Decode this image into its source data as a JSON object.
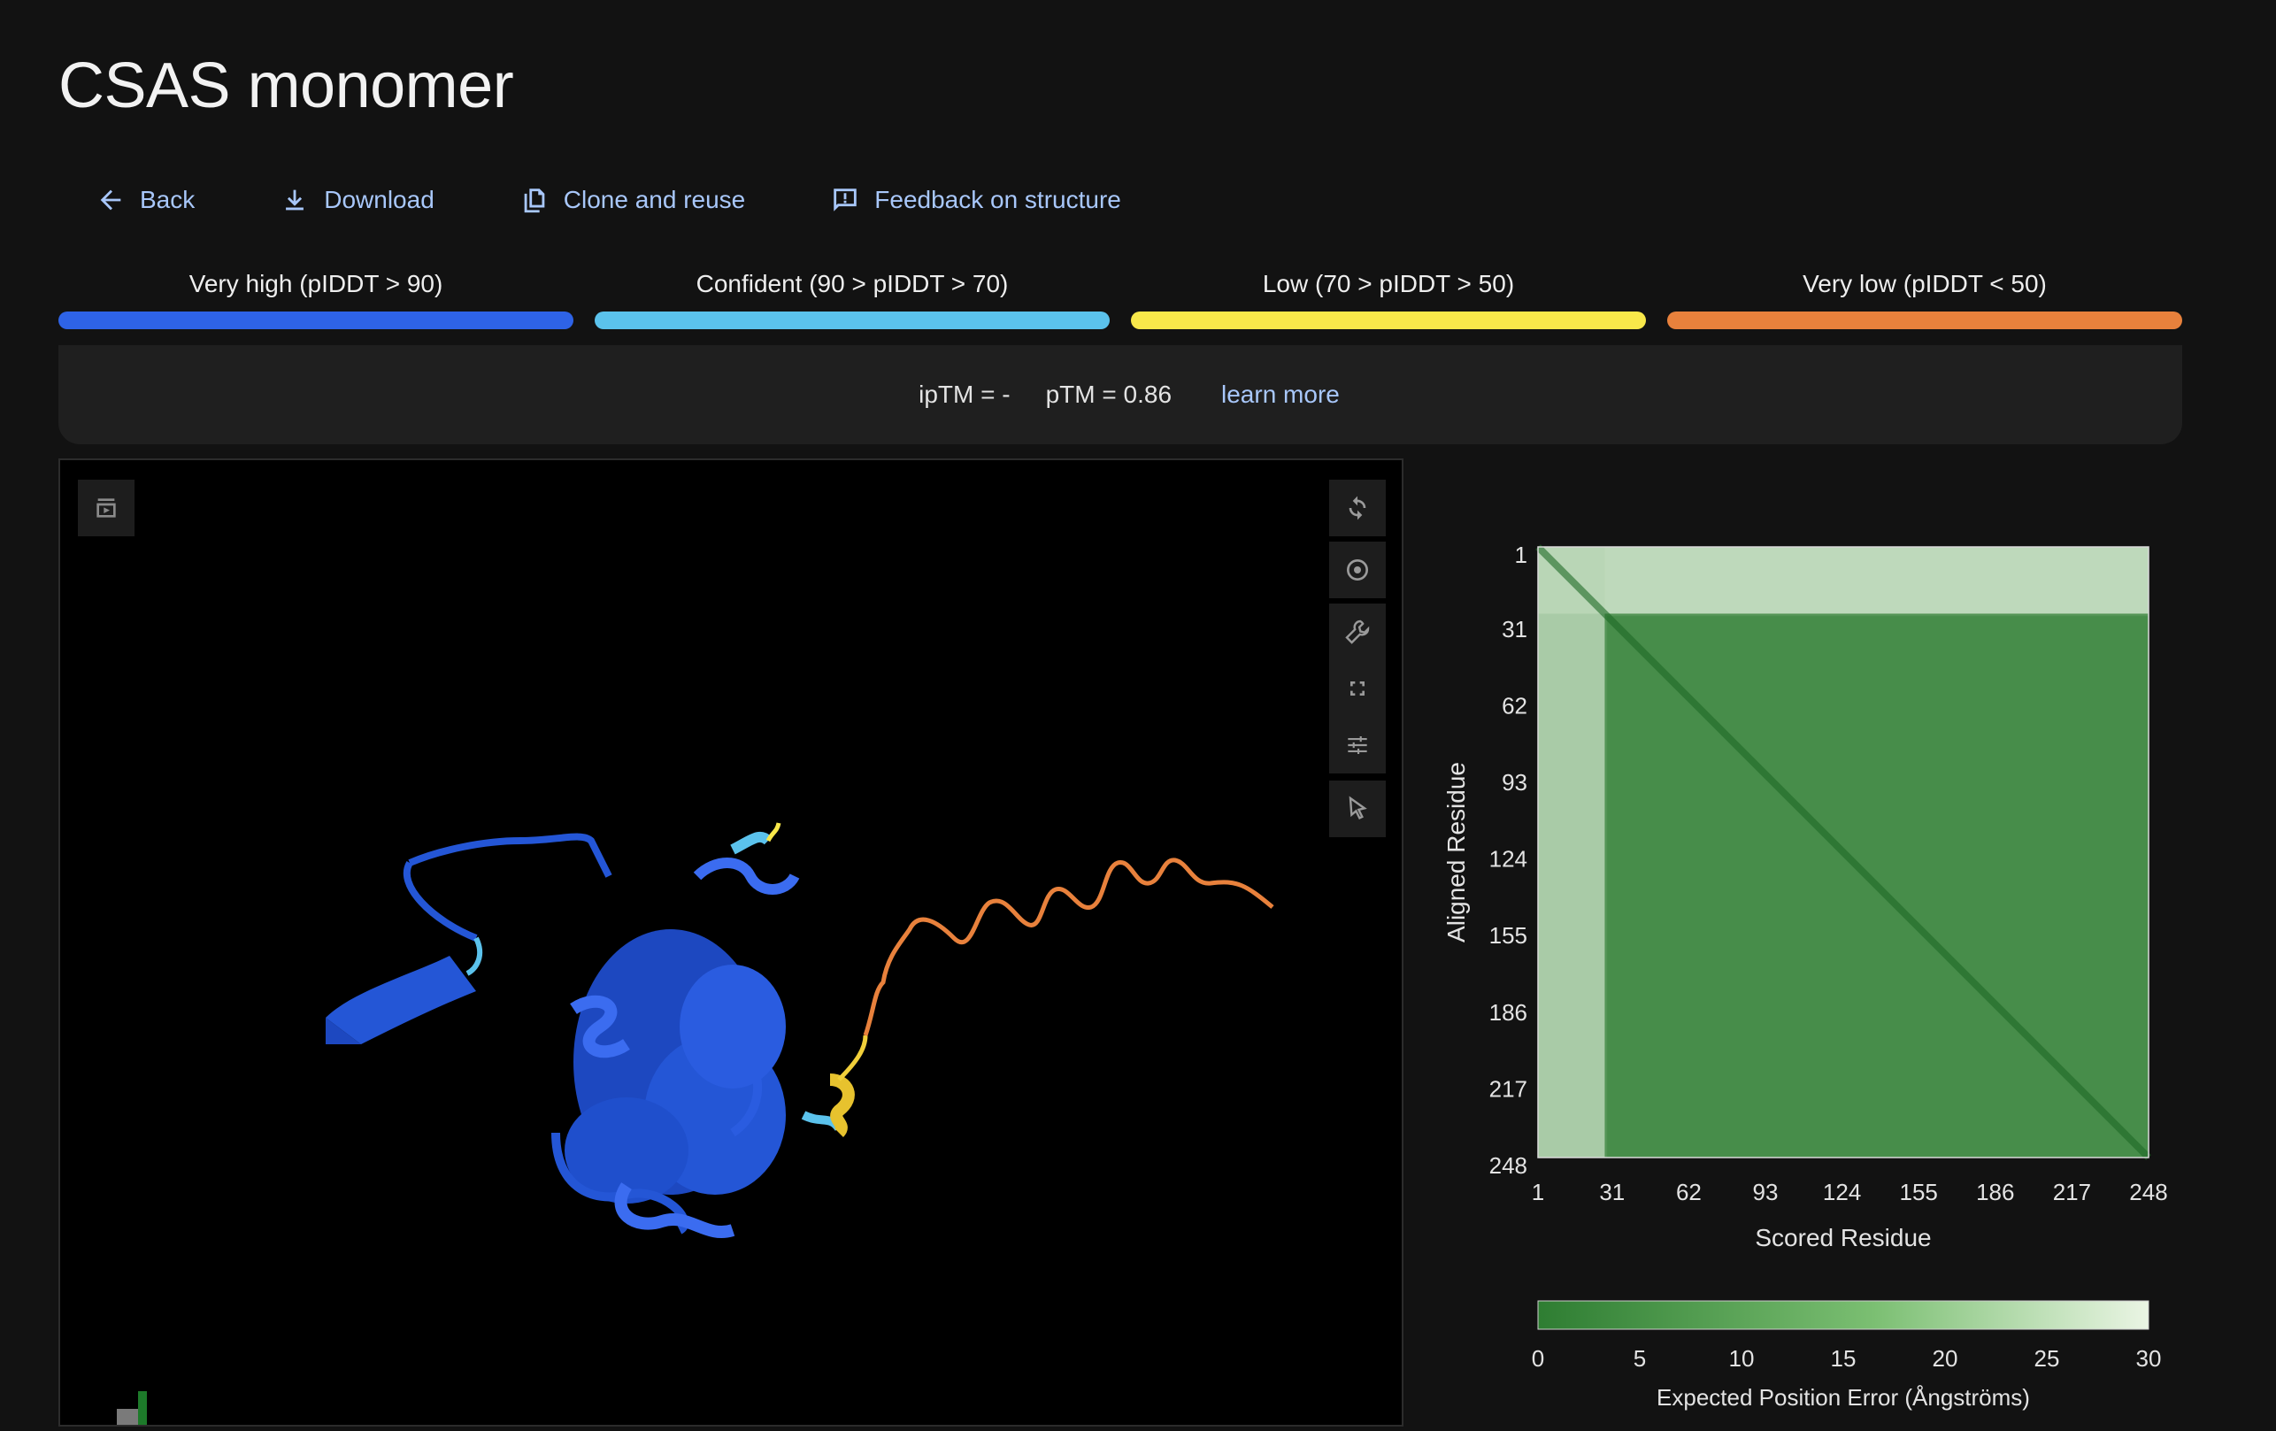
{
  "page": {
    "title": "CSAS monomer"
  },
  "actions": [
    {
      "label": "Back",
      "icon": "arrow-left-icon"
    },
    {
      "label": "Download",
      "icon": "download-icon"
    },
    {
      "label": "Clone and reuse",
      "icon": "copy-icon"
    },
    {
      "label": "Feedback on structure",
      "icon": "feedback-icon"
    }
  ],
  "legend": [
    {
      "label": "Very high (pIDDT > 90)",
      "color": "#2e63e7"
    },
    {
      "label": "Confident (90 > pIDDT > 70)",
      "color": "#5bc2ec"
    },
    {
      "label": "Low (70 > pIDDT > 50)",
      "color": "#f8e84a"
    },
    {
      "label": "Very low (pIDDT < 50)",
      "color": "#e8813c"
    }
  ],
  "metrics": {
    "iptm": "ipTM = -",
    "ptm": "pTM = 0.86",
    "learn_more": "learn more"
  },
  "viewer": {
    "left_tool": "animation-icon",
    "tools": [
      "reset-view-icon",
      "screenshot-icon",
      "settings-wrench-icon",
      "fullscreen-icon",
      "controls-icon",
      "selection-mode-icon"
    ]
  },
  "pae": {
    "ylabel": "Aligned Residue",
    "xlabel": "Scored Residue",
    "ticks": [
      "1",
      "31",
      "62",
      "93",
      "124",
      "155",
      "186",
      "217",
      "248"
    ],
    "colorbar_ticks": [
      "0",
      "5",
      "10",
      "15",
      "20",
      "25",
      "30"
    ],
    "colorbar_label": "Expected Position Error (Ångströms)",
    "colors": {
      "low": "#2e7d32",
      "high": "#eaf5e4"
    }
  },
  "chart_data": {
    "type": "heatmap",
    "title": "",
    "xlabel": "Scored Residue",
    "ylabel": "Aligned Residue",
    "x_ticks": [
      1,
      31,
      62,
      93,
      124,
      155,
      186,
      217,
      248
    ],
    "y_ticks": [
      1,
      31,
      62,
      93,
      124,
      155,
      186,
      217,
      248
    ],
    "residue_range": [
      1,
      248
    ],
    "color_scale": {
      "min": 0,
      "max": 30,
      "ticks": [
        0,
        5,
        10,
        15,
        20,
        25,
        30
      ],
      "label": "Expected Position Error (Ångströms)"
    },
    "regions": [
      {
        "aligned": [
          1,
          28
        ],
        "scored": [
          1,
          248
        ],
        "pae_approx": 26
      },
      {
        "aligned": [
          1,
          248
        ],
        "scored": [
          1,
          28
        ],
        "pae_approx": 22
      },
      {
        "aligned": [
          29,
          248
        ],
        "scored": [
          29,
          248
        ],
        "pae_approx": 4
      }
    ]
  }
}
